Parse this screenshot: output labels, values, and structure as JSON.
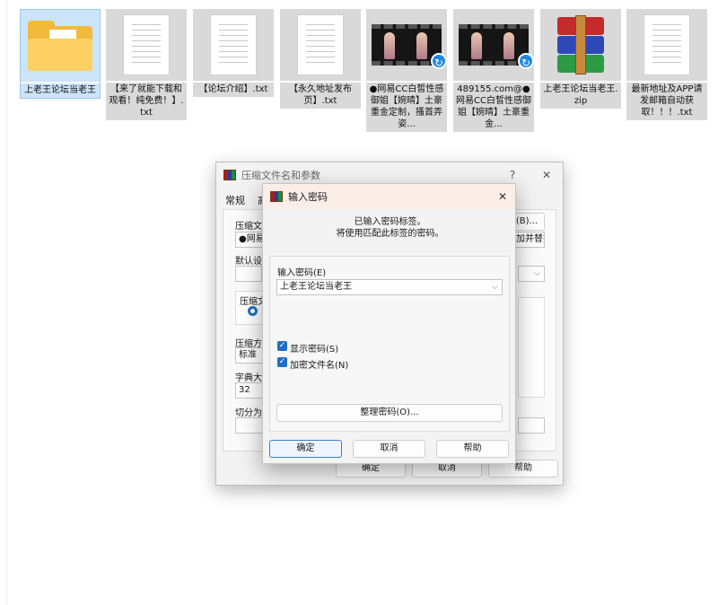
{
  "files": [
    {
      "name": "上老王论坛当老王",
      "kind": "folder",
      "selected": true
    },
    {
      "name": "【来了就能下载和观看！纯免费！】.txt",
      "kind": "text"
    },
    {
      "name": "【论坛介绍】.txt",
      "kind": "text"
    },
    {
      "name": "【永久地址发布页】.txt",
      "kind": "text"
    },
    {
      "name": "●网易CC白皙性感御姐【婉晴】土豪重金定制，搔首弄姿...",
      "kind": "video"
    },
    {
      "name": "489155.com@●网易CC白皙性感御姐【婉晴】土豪重金...",
      "kind": "video"
    },
    {
      "name": "上老王论坛当老王.zip",
      "kind": "archive"
    },
    {
      "name": "最新地址及APP请发邮箱自动获取！！！.txt",
      "kind": "text"
    }
  ],
  "archive_dialog": {
    "title": "压缩文件名和参数",
    "help_glyph": "?",
    "close_glyph": "✕",
    "tab_general": "常规",
    "tab_next": "高",
    "archive_name_label": "压缩文件",
    "archive_name_value": "●网易",
    "browse_label": "(B)...",
    "update_mode_value": "添加并替换",
    "default_profile_label": "默认设",
    "format_group_label": "压缩文",
    "method_label": "压缩方",
    "method_value": "标准",
    "dict_label": "字典大小",
    "dict_value": "32",
    "split_label": "切分为",
    "ok": "确定",
    "cancel": "取消",
    "help": "帮助"
  },
  "password_dialog": {
    "title": "输入密码",
    "close_glyph": "✕",
    "notice_line1": "已输入密码标签。",
    "notice_line2": "将使用匹配此标签的密码。",
    "field_label": "输入密码(E)",
    "field_value": "上老王论坛当老王",
    "show_password_label": "显示密码(S)",
    "show_password_checked": true,
    "encrypt_names_label": "加密文件名(N)",
    "encrypt_names_checked": true,
    "organize_button": "整理密码(O)...",
    "ok": "确定",
    "cancel": "取消",
    "help": "帮助"
  }
}
